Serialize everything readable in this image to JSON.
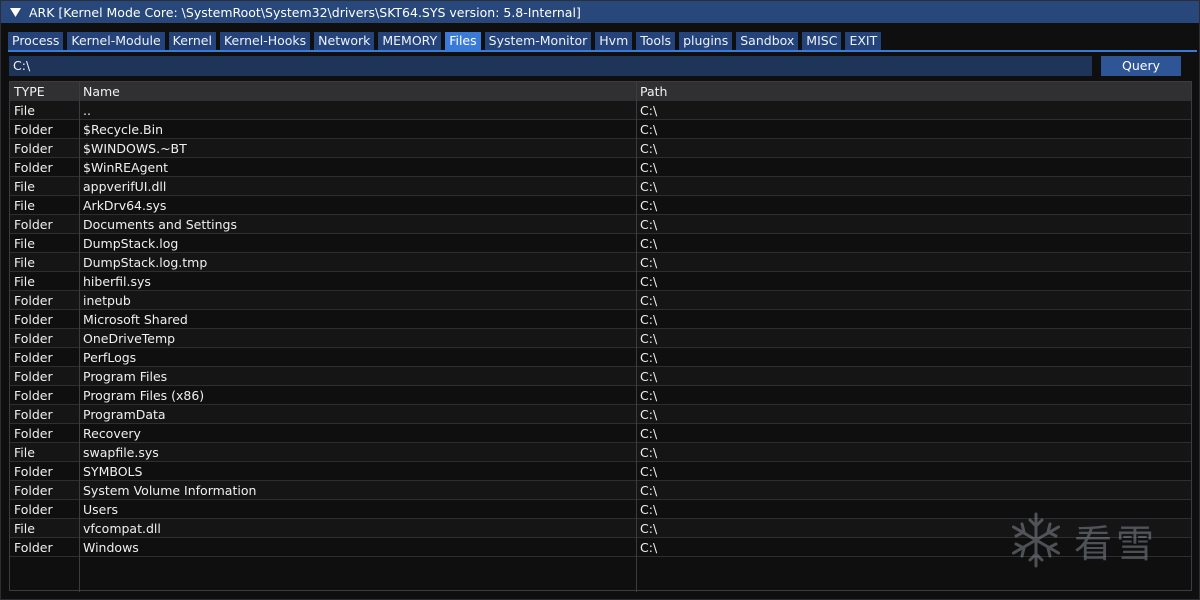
{
  "window": {
    "title": "ARK [Kernel Mode Core: \\SystemRoot\\System32\\drivers\\SKT64.SYS version: 5.8-Internal]"
  },
  "tabs": [
    {
      "label": "Process",
      "active": false
    },
    {
      "label": "Kernel-Module",
      "active": false
    },
    {
      "label": "Kernel",
      "active": false
    },
    {
      "label": "Kernel-Hooks",
      "active": false
    },
    {
      "label": "Network",
      "active": false
    },
    {
      "label": "MEMORY",
      "active": false
    },
    {
      "label": "Files",
      "active": true
    },
    {
      "label": "System-Monitor",
      "active": false
    },
    {
      "label": "Hvm",
      "active": false
    },
    {
      "label": "Tools",
      "active": false
    },
    {
      "label": "plugins",
      "active": false
    },
    {
      "label": "Sandbox",
      "active": false
    },
    {
      "label": "MISC",
      "active": false
    },
    {
      "label": "EXIT",
      "active": false
    }
  ],
  "path_input": {
    "value": "C:\\"
  },
  "query_button": {
    "label": "Query"
  },
  "table": {
    "columns": [
      "TYPE",
      "Name",
      "Path"
    ],
    "rows": [
      [
        "File",
        "..",
        "C:\\"
      ],
      [
        "Folder",
        "$Recycle.Bin",
        "C:\\"
      ],
      [
        "Folder",
        "$WINDOWS.~BT",
        "C:\\"
      ],
      [
        "Folder",
        "$WinREAgent",
        "C:\\"
      ],
      [
        "File",
        "appverifUI.dll",
        "C:\\"
      ],
      [
        "File",
        "ArkDrv64.sys",
        "C:\\"
      ],
      [
        "Folder",
        "Documents and Settings",
        "C:\\"
      ],
      [
        "File",
        "DumpStack.log",
        "C:\\"
      ],
      [
        "File",
        "DumpStack.log.tmp",
        "C:\\"
      ],
      [
        "File",
        "hiberfil.sys",
        "C:\\"
      ],
      [
        "Folder",
        "inetpub",
        "C:\\"
      ],
      [
        "Folder",
        "Microsoft Shared",
        "C:\\"
      ],
      [
        "Folder",
        "OneDriveTemp",
        "C:\\"
      ],
      [
        "Folder",
        "PerfLogs",
        "C:\\"
      ],
      [
        "Folder",
        "Program Files",
        "C:\\"
      ],
      [
        "Folder",
        "Program Files (x86)",
        "C:\\"
      ],
      [
        "Folder",
        "ProgramData",
        "C:\\"
      ],
      [
        "Folder",
        "Recovery",
        "C:\\"
      ],
      [
        "File",
        "swapfile.sys",
        "C:\\"
      ],
      [
        "Folder",
        "SYMBOLS",
        "C:\\"
      ],
      [
        "Folder",
        "System Volume Information",
        "C:\\"
      ],
      [
        "Folder",
        "Users",
        "C:\\"
      ],
      [
        "File",
        "vfcompat.dll",
        "C:\\"
      ],
      [
        "Folder",
        "Windows",
        "C:\\"
      ]
    ]
  },
  "watermark": {
    "text": "看雪",
    "icon": "snowflake-icon"
  },
  "colors": {
    "titlebar": "#28477a",
    "tab": "#23437a",
    "tab_active": "#3a7ad9",
    "button": "#2e5596",
    "background": "#0f0f10"
  }
}
